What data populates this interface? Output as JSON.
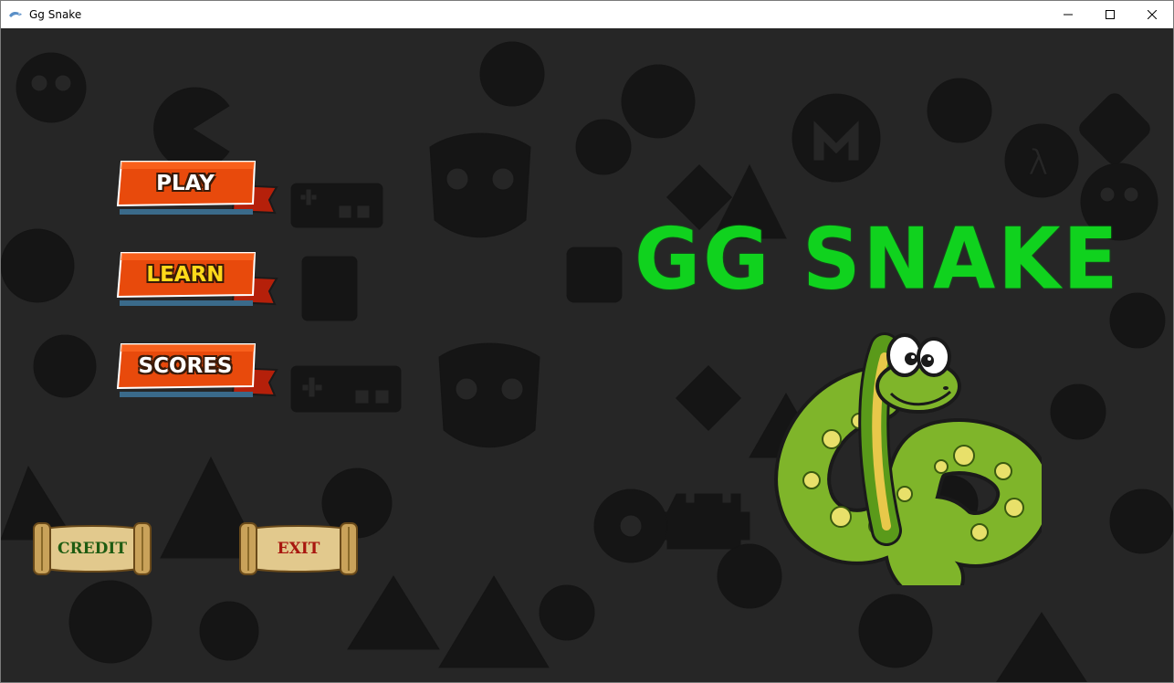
{
  "window": {
    "title": "Gg Snake",
    "app_icon": "snake-app-icon",
    "controls": {
      "minimize_icon": "minimize-icon",
      "maximize_icon": "maximize-icon",
      "close_icon": "close-icon"
    }
  },
  "menu": {
    "play_label": "PLAY",
    "learn_label": "LEARN",
    "scores_label": "SCORES"
  },
  "footer": {
    "credit_label": "CREDIT",
    "exit_label": "EXIT"
  },
  "game_title": "GG SNAKE",
  "mascot_icon": "cartoon-snake",
  "colors": {
    "ribbon_fill": "#e84a0c",
    "title_green": "#10d21e",
    "scroll_text": "#1f5c12",
    "exit_text": "#a8170f",
    "background": "#262626"
  }
}
